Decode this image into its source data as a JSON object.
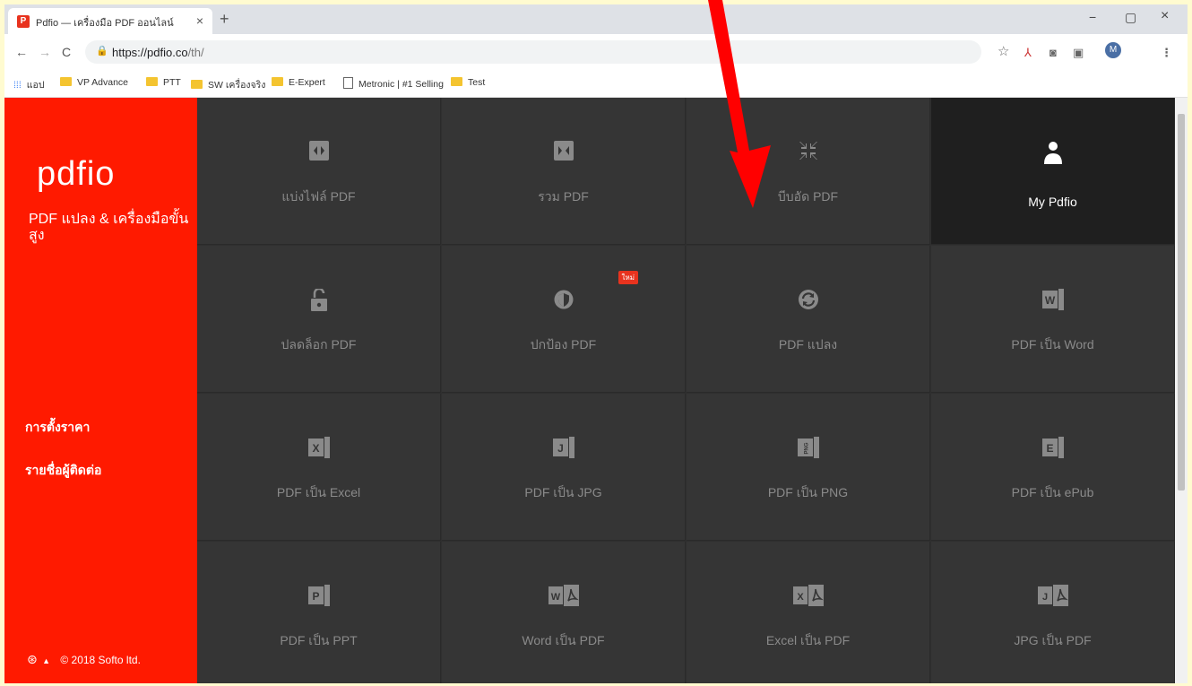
{
  "browser": {
    "tab": {
      "favicon": "P",
      "title": "Pdfio — เครื่องมือ PDF ออนไลน์",
      "close": "×"
    },
    "new_tab": "+",
    "window": {
      "minimize": "−",
      "maximize": "▢",
      "close": "×"
    },
    "nav": {
      "back": "←",
      "forward": "→",
      "reload": "C"
    },
    "url": {
      "host": "https://pdfio.co",
      "path": "/th/"
    },
    "profile_initial": "M",
    "bookmarks": [
      "แอป",
      "VP Advance",
      "PTT",
      "SW เครื่องจริง",
      "E-Expert",
      "Metronic | #1 Selling",
      "Test"
    ]
  },
  "sidebar": {
    "logo": "pdfio",
    "tagline": "PDF แปลง & เครื่องมือขั้นสูง",
    "links": [
      "การตั้งราคา",
      "รายชื่อผู้ติดต่อ"
    ],
    "footer": "© 2018 Softo ltd.",
    "language_icon": "globe-icon"
  },
  "tiles": [
    {
      "label": "แบ่งไฟล์ PDF",
      "icon": "split-icon"
    },
    {
      "label": "รวม PDF",
      "icon": "merge-icon"
    },
    {
      "label": "บีบอัด PDF",
      "icon": "compress-icon"
    },
    {
      "label": "My Pdfio",
      "icon": "user-icon"
    },
    {
      "label": "ปลดล็อก PDF",
      "icon": "unlock-icon"
    },
    {
      "label": "ปกป้อง PDF",
      "icon": "shield-icon",
      "badge": "ใหม่"
    },
    {
      "label": "PDF แปลง",
      "icon": "convert-icon"
    },
    {
      "label": "PDF เป็น Word",
      "icon": "word-icon"
    },
    {
      "label": "PDF เป็น Excel",
      "icon": "excel-icon"
    },
    {
      "label": "PDF เป็น JPG",
      "icon": "jpg-icon"
    },
    {
      "label": "PDF เป็น PNG",
      "icon": "png-icon"
    },
    {
      "label": "PDF เป็น ePub",
      "icon": "epub-icon"
    },
    {
      "label": "PDF เป็น PPT",
      "icon": "ppt-icon"
    },
    {
      "label": "Word เป็น PDF",
      "icon": "word-to-pdf-icon"
    },
    {
      "label": "Excel เป็น PDF",
      "icon": "excel-to-pdf-icon"
    },
    {
      "label": "JPG เป็น PDF",
      "icon": "jpg-to-pdf-icon"
    }
  ],
  "colors": {
    "brand": "#ff1a00",
    "tile": "#353535",
    "tile_active": "#1f1f1f",
    "arrow": "#ff0000"
  }
}
